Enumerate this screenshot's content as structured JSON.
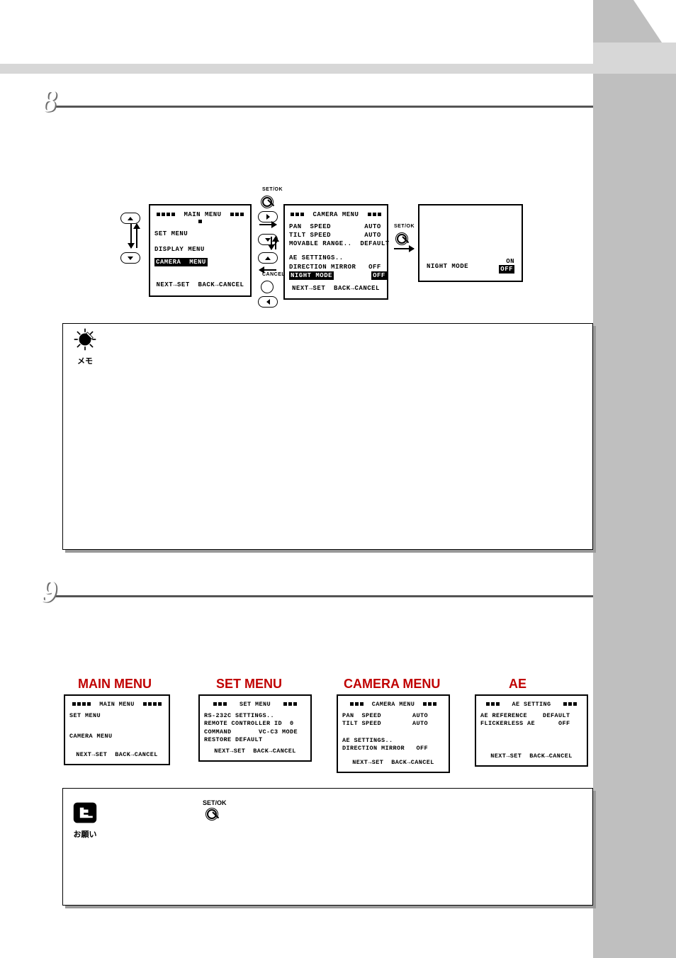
{
  "step8": "8",
  "step9": "9",
  "setok": "SET/OK",
  "cancel_label": "CANCEL",
  "memo_label": "メモ",
  "notice_label": "お願い",
  "upper": {
    "main": {
      "title": "MAIN  MENU",
      "l1": "SET MENU",
      "l2": "DISPLAY MENU",
      "l3": "CAMERA  MENU",
      "footer": "NEXT→SET  BACK→CANCEL"
    },
    "camera": {
      "title": "CAMERA MENU",
      "l1": "PAN  SPEED        AUTO",
      "l2": "TILT SPEED        AUTO",
      "l3": "MOVABLE RANGE..  DEFAULT",
      "l4": "AE SETTINGS..",
      "l5": "DIRECTION MIRROR   OFF",
      "l6": "NIGHT MODE",
      "l6r": "OFF",
      "footer": "NEXT→SET  BACK→CANCEL"
    },
    "night": {
      "l1": "NIGHT MODE",
      "r1": "ON",
      "r2": "OFF"
    }
  },
  "lower": {
    "headings": {
      "main": "MAIN MENU",
      "set": "SET MENU",
      "camera": "CAMERA MENU",
      "ae": "AE"
    },
    "main": {
      "title": "MAIN  MENU",
      "l1": "SET MENU",
      "l2": "CAMERA MENU",
      "footer": "NEXT→SET  BACK→CANCEL"
    },
    "set": {
      "title": "SET MENU",
      "l1": "RS-232C SETTINGS..",
      "l2": "REMOTE CONTROLLER ID  0",
      "l3": "COMMAND       VC-C3 MODE",
      "l4": "RESTORE DEFAULT",
      "footer": "NEXT→SET  BACK→CANCEL"
    },
    "camera": {
      "title": "CAMERA MENU",
      "l1": "PAN  SPEED        AUTO",
      "l2": "TILT SPEED        AUTO",
      "l3": "AE SETTINGS..",
      "l4": "DIRECTION MIRROR   OFF",
      "footer": "NEXT→SET  BACK→CANCEL"
    },
    "ae": {
      "title": "AE SETTING",
      "l1": "AE REFERENCE    DEFAULT",
      "l2": "FLICKERLESS AE      OFF",
      "footer": "NEXT→SET  BACK→CANCEL"
    }
  }
}
